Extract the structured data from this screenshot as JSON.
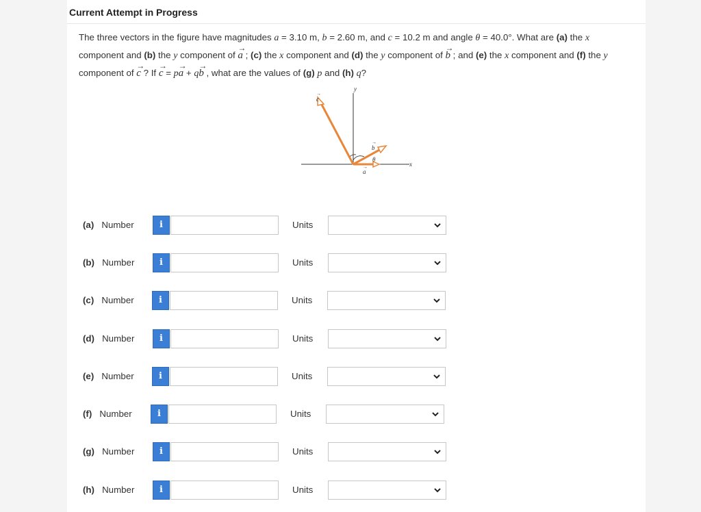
{
  "header": {
    "title": "Current Attempt in Progress"
  },
  "question": {
    "l1_a": "The three vectors in the figure have magnitudes ",
    "a_var": "a",
    "l1_b": " = 3.10 m, ",
    "b_var": "b",
    "l1_c": " = 2.60 m, and ",
    "c_var": "c",
    "l1_d": " = 10.2 m and angle ",
    "theta": "θ",
    "l1_e": " = 40.0°. What are ",
    "pa": "(a)",
    "l1_f": " the ",
    "x1": "x",
    "l2_a": "component and ",
    "pb": "(b)",
    "l2_b": " the ",
    "y1": "y",
    "l2_c": " component of ",
    "vec_a1": "a",
    "l2_d": " ; ",
    "pc": "(c)",
    "l2_e": " the ",
    "x2": "x",
    "l2_f": " component and ",
    "pd": "(d)",
    "l2_g": " the ",
    "y2": "y",
    "l2_h": " component of ",
    "vec_b1": "b",
    "l2_i": " ; and ",
    "pe": "(e)",
    "l2_j": " the ",
    "x3": "x",
    "l2_k": " component and ",
    "pf": "(f)",
    "l2_l": " the ",
    "y3": "y",
    "l3_a": "component of ",
    "vec_c1": "c",
    "l3_b": " ? If ",
    "vec_c2": "c",
    "l3_c": " = ",
    "p1": "p",
    "vec_a2": "a",
    "l3_d": " + ",
    "q1": "q",
    "vec_b2": "b",
    "l3_e": " , what are the values of ",
    "pg": "(g)",
    "p2": "p",
    "l3_f": " and ",
    "ph": "(h)",
    "q2": "q",
    "l3_g": "?"
  },
  "figure": {
    "y_label": "y",
    "x_label": "x",
    "c_label": "c",
    "b_label": "b",
    "a_label": "a",
    "theta_label": "θ",
    "vector_color": "#e8873a",
    "axis_color": "#333333"
  },
  "rows": [
    {
      "label": "(a)",
      "number_label": "Number",
      "info": "i",
      "value": "",
      "units_label": "Units",
      "units_value": ""
    },
    {
      "label": "(b)",
      "number_label": "Number",
      "info": "i",
      "value": "",
      "units_label": "Units",
      "units_value": ""
    },
    {
      "label": "(c)",
      "number_label": "Number",
      "info": "i",
      "value": "",
      "units_label": "Units",
      "units_value": ""
    },
    {
      "label": "(d)",
      "number_label": "Number",
      "info": "i",
      "value": "",
      "units_label": "Units",
      "units_value": ""
    },
    {
      "label": "(e)",
      "number_label": "Number",
      "info": "i",
      "value": "",
      "units_label": "Units",
      "units_value": ""
    },
    {
      "label": "(f)",
      "number_label": "Number",
      "info": "i",
      "value": "",
      "units_label": "Units",
      "units_value": ""
    },
    {
      "label": "(g)",
      "number_label": "Number",
      "info": "i",
      "value": "",
      "units_label": "Units",
      "units_value": ""
    },
    {
      "label": "(h)",
      "number_label": "Number",
      "info": "i",
      "value": "",
      "units_label": "Units",
      "units_value": ""
    }
  ],
  "colors": {
    "info_button": "#3a7fd5"
  }
}
